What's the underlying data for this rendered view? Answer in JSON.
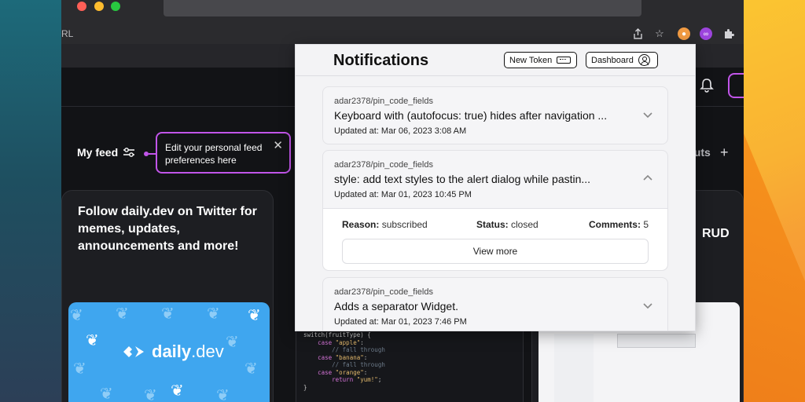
{
  "browser": {
    "url_fragment": "RL"
  },
  "page": {
    "my_feed_label": "My feed",
    "tooltip_text": "Edit your personal feed preferences here",
    "shortcuts_label": "cuts",
    "twitter_card_title": "Follow daily.dev on Twitter for memes, updates, announcements and more!",
    "brand_daily": "daily",
    "brand_dev": ".dev",
    "card3_text": "RUD",
    "card3_dot": "."
  },
  "code_snippet": {
    "line1": "switch(fruitType) {",
    "line2_kw": "case",
    "line2_str": "\"apple\"",
    "line3": "// fall through",
    "line4_kw": "case",
    "line4_str": "\"banana\"",
    "line5": "// fall through",
    "line6_kw": "case",
    "line6_str": "\"orange\"",
    "line7_kw": "return",
    "line7_str": "\"yum!\"",
    "line8": "}"
  },
  "notifications": {
    "title": "Notifications",
    "new_token_label": "New Token",
    "dashboard_label": "Dashboard",
    "items": [
      {
        "repo": "adar2378/pin_code_fields",
        "title": "Keyboard with (autofocus: true) hides after navigation ...",
        "updated": "Updated at: Mar 06, 2023 3:08 AM"
      },
      {
        "repo": "adar2378/pin_code_fields",
        "title": "style: add text styles to the alert dialog while pastin...",
        "updated": "Updated at: Mar 01, 2023 10:45 PM",
        "reason_label": "Reason:",
        "reason": "subscribed",
        "status_label": "Status:",
        "status": "closed",
        "comments_label": "Comments:",
        "comments": "5",
        "view_more": "View more"
      },
      {
        "repo": "adar2378/pin_code_fields",
        "title": "Adds a separator Widget.",
        "updated": "Updated at: Mar 01, 2023 7:46 PM"
      }
    ]
  },
  "colors": {
    "accent": "#c155e9",
    "twitter_blue": "#3fa6ef"
  }
}
